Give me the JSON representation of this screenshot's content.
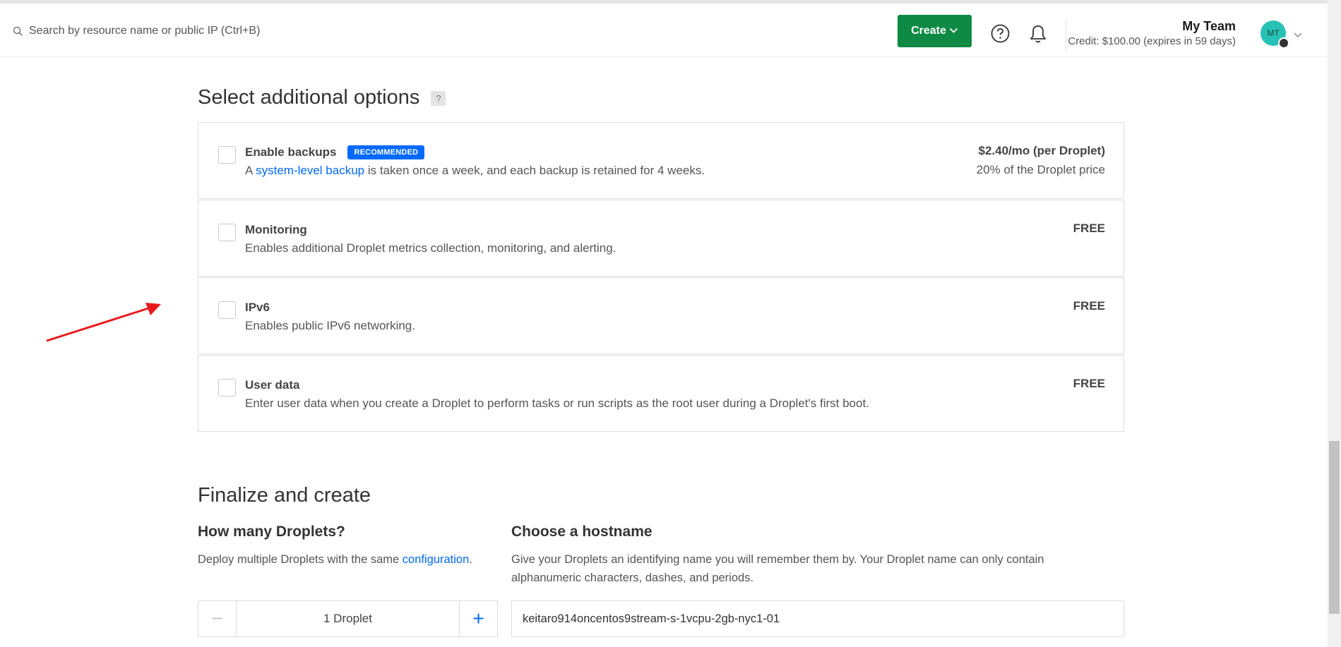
{
  "topbar": {
    "search_placeholder": "Search by resource name or public IP (Ctrl+B)",
    "create_label": "Create",
    "team_name": "My Team",
    "credit_text": "Credit: $100.00 (expires in 59 days)",
    "avatar_initials": "MT",
    "icons": [
      "search-icon",
      "chevron-down-icon",
      "help-icon",
      "bell-icon",
      "chevron-down-icon"
    ]
  },
  "additional_options": {
    "heading": "Select additional options",
    "help_badge": "?",
    "options": [
      {
        "title": "Enable backups",
        "badge": "RECOMMENDED",
        "desc_prefix": "A ",
        "desc_link": "system-level backup",
        "desc_suffix": " is taken once a week, and each backup is retained for 4 weeks.",
        "price": "$2.40/mo (per Droplet)",
        "price_sub": "20% of the Droplet price",
        "checked": false
      },
      {
        "title": "Monitoring",
        "desc": "Enables additional Droplet metrics collection, monitoring, and alerting.",
        "price": "FREE",
        "checked": false
      },
      {
        "title": "IPv6",
        "desc": "Enables public IPv6 networking.",
        "price": "FREE",
        "checked": false
      },
      {
        "title": "User data",
        "desc": "Enter user data when you create a Droplet to perform tasks or run scripts as the root user during a Droplet's first boot.",
        "price": "FREE",
        "checked": false
      }
    ]
  },
  "finalize": {
    "heading": "Finalize and create",
    "droplets": {
      "heading": "How many Droplets?",
      "desc_prefix": "Deploy multiple Droplets with the same ",
      "desc_link": "configuration",
      "desc_suffix": ".",
      "minus": "−",
      "count_label": "1  Droplet",
      "plus": "+"
    },
    "hostname": {
      "heading": "Choose a hostname",
      "desc_line1": "Give your Droplets an identifying name you will remember them by. Your Droplet name can only contain",
      "desc_line2": "alphanumeric characters, dashes, and periods.",
      "value": "keitaro914oncentos9stream-s-1vcpu-2gb-nyc1-01"
    }
  },
  "colors": {
    "create_button": "#0f8a44",
    "link": "#0069ff",
    "badge": "#0069ff",
    "avatar": "#27c2b5",
    "annotation_arrow": "#e8191c"
  }
}
